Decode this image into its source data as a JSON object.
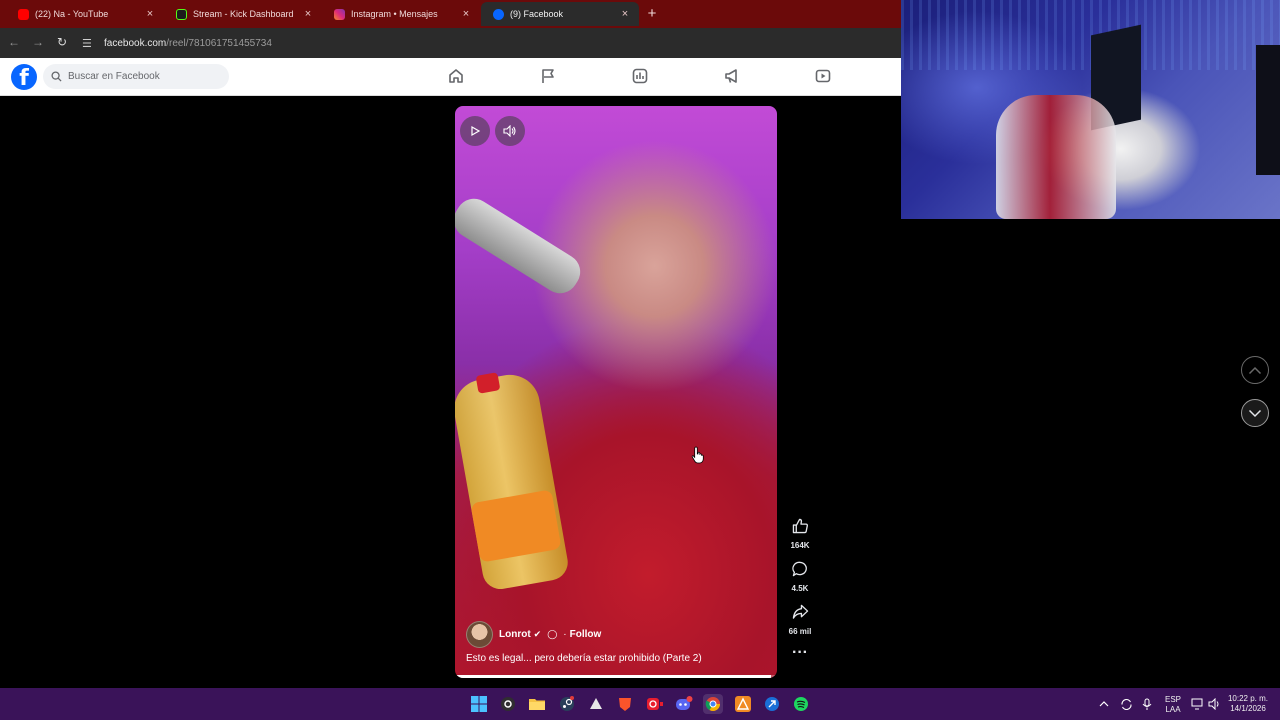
{
  "browser": {
    "tabs": [
      {
        "label": "(22) Na - YouTube",
        "icon": "youtube-icon",
        "color": "#ff0000"
      },
      {
        "label": "Stream - Kick Dashboard",
        "icon": "kick-icon",
        "color": "#53fc18"
      },
      {
        "label": "Instagram • Mensajes",
        "icon": "instagram-icon",
        "color": "#e1306c"
      },
      {
        "label": "(9) Facebook",
        "icon": "facebook-icon",
        "color": "#0866ff",
        "active": true
      }
    ],
    "new_tab_label": "+",
    "close_label": "×",
    "url_host": "facebook.com",
    "url_path": "/reel/781061751455734"
  },
  "facebook": {
    "logo": "f",
    "search_placeholder": "Buscar en Facebook",
    "nav_icons": [
      "home-icon",
      "flag-icon",
      "chart-icon",
      "megaphone-icon",
      "video-icon"
    ]
  },
  "reel": {
    "author": "Lonrot",
    "separator": "·",
    "follow_label": "Follow",
    "caption": "Esto es legal... pero debería estar prohibido (Parte 2)",
    "progress": 0.98,
    "likes": "164K",
    "comments": "4.5K",
    "shares": "66 mil",
    "more_label": "···"
  },
  "taskbar": {
    "lang_top": "ESP",
    "lang_bottom": "LAA",
    "time": "10:22 p. m.",
    "date": "14/1/2026"
  },
  "colors": {
    "browser_tabbar": "#6b0a0a",
    "facebook_blue": "#0866ff",
    "taskbar": "#3a1359"
  }
}
